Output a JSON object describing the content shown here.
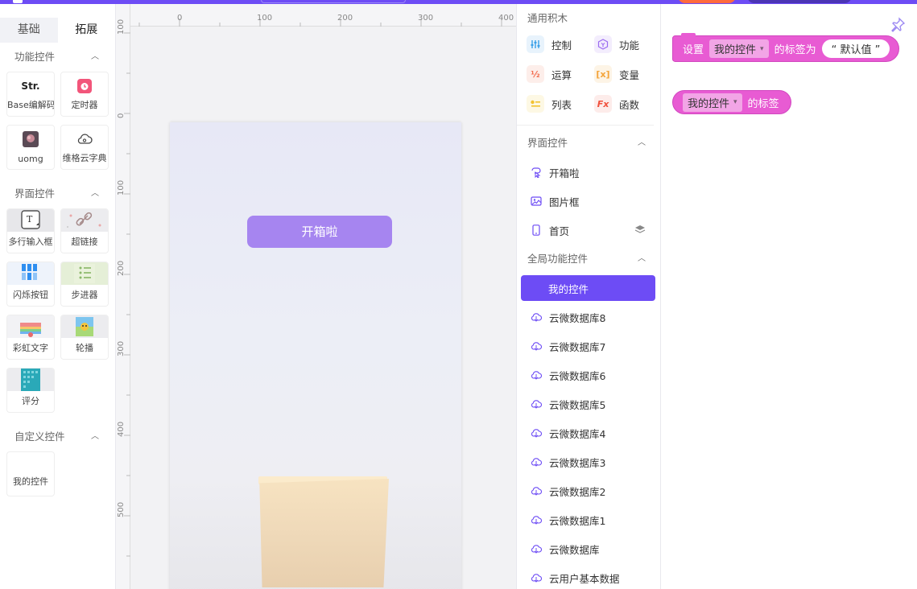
{
  "left_panel": {
    "tabs": [
      "基础",
      "拓展"
    ],
    "sections": [
      {
        "title": "功能控件",
        "items": [
          {
            "label": "Base编解码",
            "icon": "str-icon",
            "icon_text": "Str."
          },
          {
            "label": "定时器",
            "icon": "timer-icon"
          },
          {
            "label": "uomg",
            "icon": "uomg-avatar"
          },
          {
            "label": "维格云字典",
            "icon": "cloud-dict-icon"
          }
        ]
      },
      {
        "title": "界面控件",
        "items": [
          {
            "label": "多行输入框",
            "icon": "textarea-icon"
          },
          {
            "label": "超链接",
            "icon": "link-icon"
          },
          {
            "label": "闪烁按钮",
            "icon": "blink-button-thumb"
          },
          {
            "label": "步进器",
            "icon": "stepper-thumb"
          },
          {
            "label": "彩虹文字",
            "icon": "rainbow-text-thumb"
          },
          {
            "label": "轮播",
            "icon": "carousel-thumb"
          },
          {
            "label": "评分",
            "icon": "rating-thumb"
          }
        ]
      },
      {
        "title": "自定义控件",
        "items": [
          {
            "label": "我的控件",
            "icon": ""
          }
        ]
      }
    ]
  },
  "canvas": {
    "ruler_top": [
      "0",
      "100",
      "200",
      "300",
      "400"
    ],
    "ruler_left": [
      "100",
      "0",
      "100",
      "200",
      "300",
      "400",
      "500"
    ],
    "open_button_label": "开箱啦"
  },
  "blocks_panel": {
    "general_title": "通用积木",
    "categories": [
      {
        "label": "控制",
        "color": "#3aa0e8",
        "icon": "control-icon"
      },
      {
        "label": "功能",
        "color": "#9b6cf0",
        "icon": "function-icon"
      },
      {
        "label": "运算",
        "color": "#f26b4d",
        "icon": "operator-icon"
      },
      {
        "label": "变量",
        "color": "#f4a43a",
        "icon": "variable-icon"
      },
      {
        "label": "列表",
        "color": "#f2c230",
        "icon": "list-icon"
      },
      {
        "label": "函数",
        "color": "#f0503c",
        "icon": "fx-icon"
      }
    ],
    "ui_title": "界面控件",
    "ui_items": [
      "开箱啦",
      "图片框",
      "首页"
    ],
    "global_title": "全局功能控件",
    "global_items": [
      "我的控件",
      "云微数据库8",
      "云微数据库7",
      "云微数据库6",
      "云微数据库5",
      "云微数据库4",
      "云微数据库3",
      "云微数据库2",
      "云微数据库1",
      "云微数据库",
      "云用户基本数据"
    ],
    "selected": "我的控件"
  },
  "workspace": {
    "block1": {
      "prefix": "设置",
      "dropdown": "我的控件",
      "middle": "的标签为",
      "value": "“ 默认值 ”"
    },
    "block2": {
      "dropdown": "我的控件",
      "suffix": "的标签"
    },
    "block_color": "#e85bd3",
    "accent": "#6d4cf5"
  }
}
